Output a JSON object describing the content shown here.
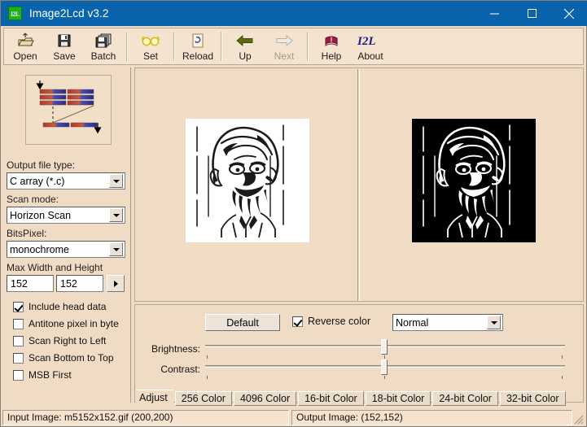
{
  "window": {
    "title": "Image2Lcd v3.2",
    "icon": "app-icon-i2l",
    "titlebar_color": "#0a64ad",
    "background_color": "#f0dcc4",
    "buttons": {
      "minimize": "minimize-icon",
      "maximize": "maximize-icon",
      "close": "close-icon"
    }
  },
  "toolbar": {
    "items": [
      {
        "label": "Open",
        "icon": "open-folder-icon",
        "enabled": true,
        "separator_after": false
      },
      {
        "label": "Save",
        "icon": "floppy-disk-icon",
        "enabled": true,
        "separator_after": false
      },
      {
        "label": "Batch",
        "icon": "stacked-disks-icon",
        "enabled": true,
        "separator_after": true
      },
      {
        "label": "Set",
        "icon": "glasses-icon",
        "enabled": true,
        "separator_after": true
      },
      {
        "label": "Reload",
        "icon": "reload-page-icon",
        "enabled": true,
        "separator_after": true
      },
      {
        "label": "Up",
        "icon": "arrow-left-icon",
        "enabled": true,
        "separator_after": false
      },
      {
        "label": "Next",
        "icon": "arrow-right-icon",
        "enabled": false,
        "separator_after": true
      },
      {
        "label": "Help",
        "icon": "help-book-icon",
        "enabled": true,
        "separator_after": false
      },
      {
        "label": "About",
        "icon": "i2l-logo-icon",
        "enabled": true,
        "separator_after": false
      }
    ]
  },
  "sidebar": {
    "scan_preview_icon": "horizon-scan-diagram",
    "output_file_type": {
      "label": "Output file type:",
      "value": "C array (*.c)"
    },
    "scan_mode": {
      "label": "Scan mode:",
      "value": "Horizon Scan"
    },
    "bits_pixel": {
      "label": "BitsPixel:",
      "value": "monochrome"
    },
    "max_size": {
      "label": "Max Width and Height",
      "width": "152",
      "height": "152",
      "apply_icon": "triangle-right-icon"
    },
    "checkboxes": [
      {
        "label": "Include head data",
        "checked": true
      },
      {
        "label": "Antitone pixel in byte",
        "checked": false
      },
      {
        "label": "Scan Right to Left",
        "checked": false
      },
      {
        "label": "Scan Bottom to Top",
        "checked": false
      },
      {
        "label": "MSB First",
        "checked": false
      }
    ]
  },
  "preview": {
    "input_image_alt": "caricature-line-drawing",
    "output_image_alt": "caricature-line-drawing-inverted"
  },
  "adjust": {
    "default_button": "Default",
    "reverse_color": {
      "label": "Reverse color",
      "checked": true
    },
    "mode": {
      "value": "Normal"
    },
    "brightness": {
      "label": "Brightness:",
      "percent": 50
    },
    "contrast": {
      "label": "Contrast:",
      "percent": 50
    }
  },
  "tabs": {
    "active": "Adjust",
    "items": [
      "Adjust",
      "256 Color",
      "4096 Color",
      "16-bit Color",
      "18-bit Color",
      "24-bit Color",
      "32-bit Color"
    ]
  },
  "statusbar": {
    "input": "Input Image: m5152x152.gif (200,200)",
    "output": "Output Image: (152,152)",
    "grip_icon": "resize-grip-icon"
  }
}
